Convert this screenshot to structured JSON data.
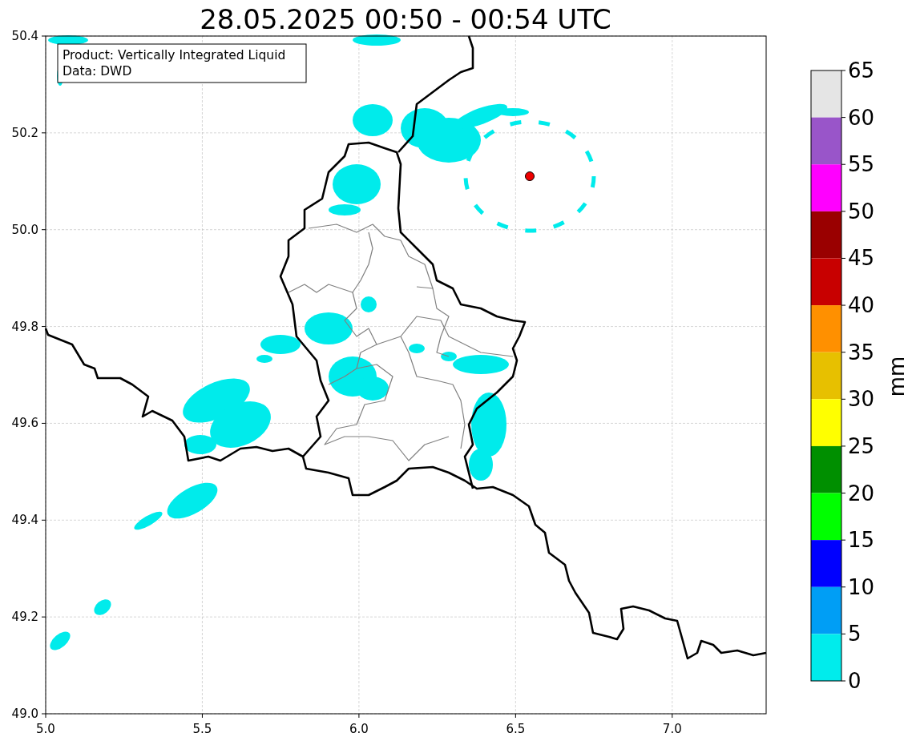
{
  "title": "28.05.2025 00:50 - 00:54 UTC",
  "legend": [
    "Product: Vertically Integrated Liquid",
    "Data: DWD"
  ],
  "x_ticks": [
    "5.0",
    "5.5",
    "6.0",
    "6.5",
    "7.0"
  ],
  "y_ticks": [
    "50.4",
    "50.2",
    "50.0",
    "49.8",
    "49.6",
    "49.4",
    "49.2",
    "49.0"
  ],
  "colorbar": {
    "label": "mm",
    "segments": [
      {
        "color": "#e5e5e5"
      },
      {
        "color": "#9955c9"
      },
      {
        "color": "#ff00ff"
      },
      {
        "color": "#9a0000"
      },
      {
        "color": "#c80000"
      },
      {
        "color": "#ff9000"
      },
      {
        "color": "#e7c000"
      },
      {
        "color": "#ffff00"
      },
      {
        "color": "#008f00"
      },
      {
        "color": "#00ff00"
      },
      {
        "color": "#0000ff"
      },
      {
        "color": "#009ef5"
      },
      {
        "color": "#00ecec"
      }
    ],
    "ticks": [
      "65",
      "60",
      "55",
      "50",
      "45",
      "40",
      "35",
      "30",
      "25",
      "20",
      "15",
      "10",
      "5",
      "0"
    ]
  }
}
